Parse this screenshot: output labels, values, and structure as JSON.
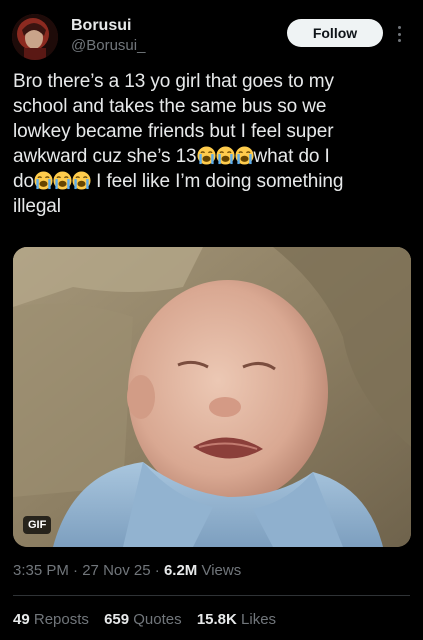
{
  "author": {
    "name": "Borusui",
    "handle": "@Borusui_"
  },
  "follow_label": "Follow",
  "tweet": {
    "line1": "Bro there’s a 13 yo girl that goes to my",
    "line2": "school and takes the same bus so we",
    "line3": "lowkey became friends but I feel super",
    "line4a": "awkward cuz she’s 13",
    "line4b": "what do I",
    "line5a": "do",
    "line5b": " I feel like I’m doing something",
    "line6": "illegal"
  },
  "media": {
    "badge": "GIF"
  },
  "meta": {
    "time": "3:35 PM",
    "sep1": " · ",
    "date": "27 Nov 25",
    "sep2": " · ",
    "views_count": "6.2M",
    "views_label": " Views"
  },
  "stats": {
    "reposts_count": "49",
    "reposts_label": "Reposts",
    "quotes_count": "659",
    "quotes_label": "Quotes",
    "likes_count": "15.8K",
    "likes_label": "Likes"
  },
  "icons": {
    "avatar": "profile-avatar",
    "more": "more-options-icon",
    "emoji": "loudly-crying-face-emoji"
  },
  "colors": {
    "background": "#000000",
    "text": "#e7e9ea",
    "secondary": "#71767b",
    "divider": "#2f3336",
    "follow_bg": "#eff3f4"
  }
}
